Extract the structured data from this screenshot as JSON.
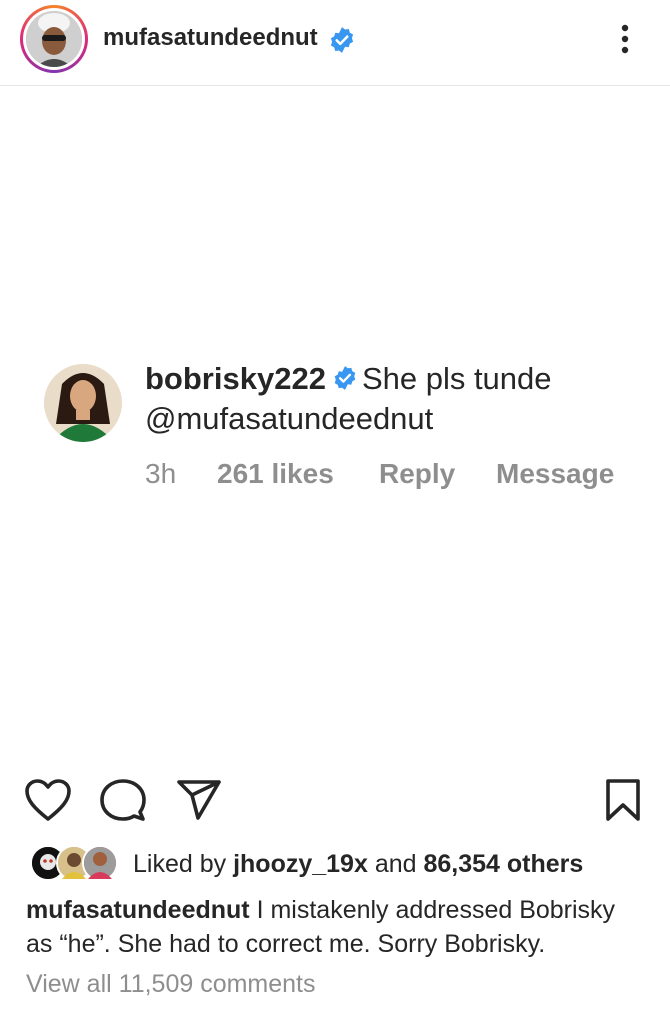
{
  "post_header": {
    "username": "mufasatundeednut",
    "verified_icon": "verified-badge-icon",
    "more_icon": "more-vertical-icon"
  },
  "comment_card": {
    "username": "bobrisky222",
    "text": "She pls tunde",
    "mention": "@mufasatundeednut",
    "time": "3h",
    "likes": "261 likes",
    "reply_label": "Reply",
    "message_label": "Message"
  },
  "actions": {
    "icons": [
      "heart-icon",
      "comment-icon",
      "send-icon",
      "bookmark-icon"
    ]
  },
  "likes_line": {
    "prefix": "Liked by",
    "user": "jhoozy_19x",
    "middle": "and",
    "others": "86,354 others"
  },
  "caption": {
    "username": "mufasatundeednut",
    "text": "I mistakenly addressed Bobrisky as “he”. She had to correct me. Sorry Bobrisky."
  },
  "view_comments": "View all 11,509 comments",
  "colors": {
    "text": "#262626",
    "secondary": "#8e8e8e",
    "verified": "#3897f0",
    "divider": "#e6e6e6"
  }
}
